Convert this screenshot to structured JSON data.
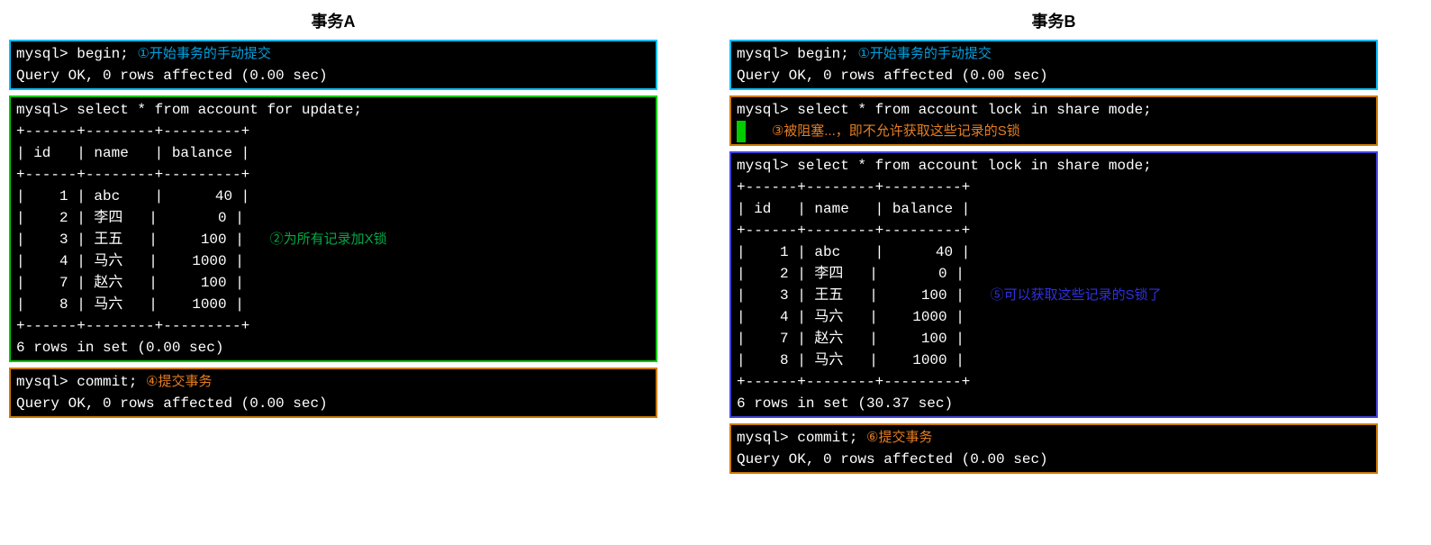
{
  "titleA": "事务A",
  "titleB": "事务B",
  "A": {
    "begin_prompt": "mysql> begin;",
    "begin_annot": "①开始事务的手动提交",
    "begin_result": "Query OK, 0 rows affected (0.00 sec)",
    "select_cmd": "mysql> select * from account for update;",
    "table_sep": "+------+--------+---------+",
    "table_head": "| id   | name   | balance |",
    "table_rows": [
      "|    1 | abc    |      40 |",
      "|    2 | 李四   |       0 |",
      "|    3 | 王五   |     100 |",
      "|    4 | 马六   |    1000 |",
      "|    7 | 赵六   |     100 |",
      "|    8 | 马六   |    1000 |"
    ],
    "select_annot": "②为所有记录加X锁",
    "select_result": "6 rows in set (0.00 sec)",
    "commit_prompt": "mysql> commit;",
    "commit_annot": "④提交事务",
    "commit_result": "Query OK, 0 rows affected (0.00 sec)"
  },
  "B": {
    "begin_prompt": "mysql> begin;",
    "begin_annot": "①开始事务的手动提交",
    "begin_result": "Query OK, 0 rows affected (0.00 sec)",
    "select1_cmd": "mysql> select * from account lock in share mode;",
    "select1_annot": "③被阻塞...，即不允许获取这些记录的S锁",
    "select2_cmd": "mysql> select * from account lock in share mode;",
    "table_sep": "+------+--------+---------+",
    "table_head": "| id   | name   | balance |",
    "table_rows": [
      "|    1 | abc    |      40 |",
      "|    2 | 李四   |       0 |",
      "|    3 | 王五   |     100 |",
      "|    4 | 马六   |    1000 |",
      "|    7 | 赵六   |     100 |",
      "|    8 | 马六   |    1000 |"
    ],
    "select2_annot": "⑤可以获取这些记录的S锁了",
    "select2_result": "6 rows in set (30.37 sec)",
    "commit_prompt": "mysql> commit;",
    "commit_annot": "⑥提交事务",
    "commit_result": "Query OK, 0 rows affected (0.00 sec)"
  }
}
